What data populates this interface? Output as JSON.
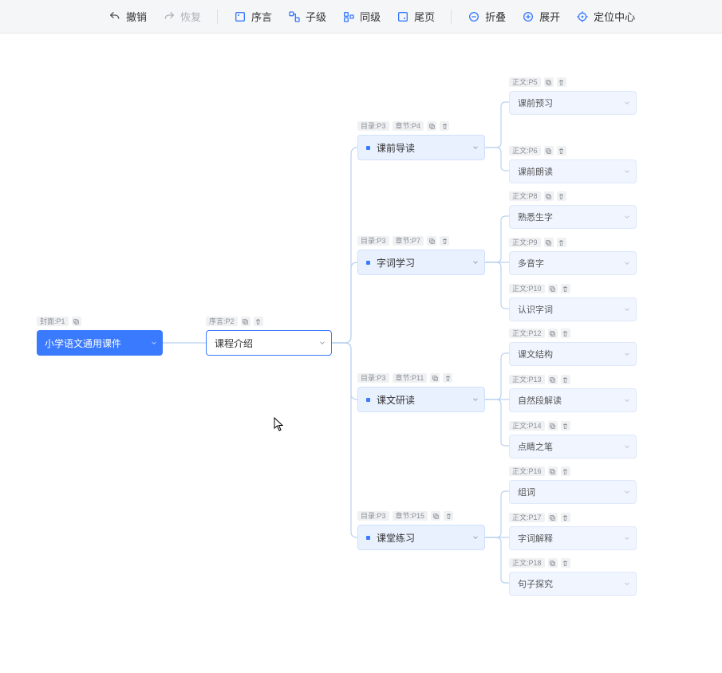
{
  "toolbar": {
    "undo": "撤销",
    "redo": "恢复",
    "preface": "序言",
    "child_level": "子级",
    "sibling_level": "同级",
    "end_page": "尾页",
    "collapse": "折叠",
    "expand": "展开",
    "locate_center": "定位中心"
  },
  "root": {
    "tag": "封面:P1",
    "label": "小学语文通用课件"
  },
  "l2": {
    "tag": "序言:P2",
    "label": "课程介绍"
  },
  "l3": [
    {
      "tag1": "目录:P3",
      "tag2": "章节:P4",
      "label": "课前导读"
    },
    {
      "tag1": "目录:P3",
      "tag2": "章节:P7",
      "label": "字词学习"
    },
    {
      "tag1": "目录:P3",
      "tag2": "章节:P11",
      "label": "课文研读"
    },
    {
      "tag1": "目录:P3",
      "tag2": "章节:P15",
      "label": "课堂练习"
    }
  ],
  "l4": [
    {
      "tag": "正文:P5",
      "label": "课前预习"
    },
    {
      "tag": "正文:P6",
      "label": "课前朗读"
    },
    {
      "tag": "正文:P8",
      "label": "熟悉生字"
    },
    {
      "tag": "正文:P9",
      "label": "多音字"
    },
    {
      "tag": "正文:P10",
      "label": "认识字词"
    },
    {
      "tag": "正文:P12",
      "label": "课文结构"
    },
    {
      "tag": "正文:P13",
      "label": "自然段解读"
    },
    {
      "tag": "正文:P14",
      "label": "点睛之笔"
    },
    {
      "tag": "正文:P16",
      "label": "组词"
    },
    {
      "tag": "正文:P17",
      "label": "字词解释"
    },
    {
      "tag": "正文:P18",
      "label": "句子探究"
    }
  ]
}
